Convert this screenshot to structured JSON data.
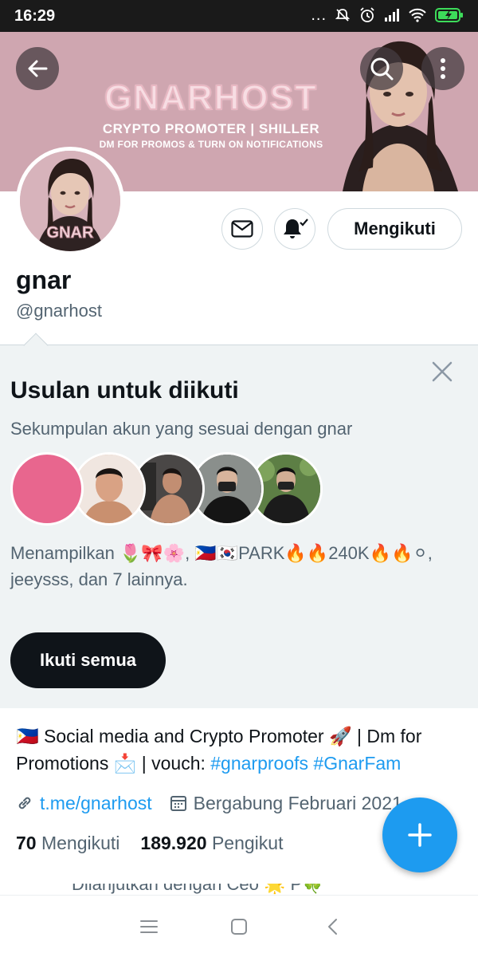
{
  "status_bar": {
    "time": "16:29",
    "dots": "..."
  },
  "banner": {
    "title": "GNARHOST",
    "subtitle": "CRYPTO PROMOTER | SHILLER",
    "tagline": "DM FOR PROMOS & TURN ON NOTIFICATIONS",
    "colors": {
      "background": "#cfa6b0"
    }
  },
  "avatar": {
    "logo_text": "GNAR"
  },
  "profile": {
    "follow_button": "Mengikuti",
    "name": "gnar",
    "handle": "@gnarhost"
  },
  "suggestions": {
    "title": "Usulan untuk diikuti",
    "subtitle": "Sekumpulan akun yang sesuai dengan gnar",
    "showing_text": "Menampilkan 🌷🎀🌸, 🇵🇭🇰🇷PARK🔥🔥240K🔥🔥⚪, jeeysss, dan 7 lainnya.",
    "follow_all": "Ikuti semua"
  },
  "bio": {
    "text_part1": "🇵🇭 Social media and Crypto Promoter 🚀 | Dm for Promotions 📩 | vouch: ",
    "hashtag1": "#gnarproofs",
    "hashtag2": "#GnarFam",
    "link": "t.me/gnarhost",
    "joined": "Bergabung Februari 2021",
    "following_count": "70",
    "following_label": "Mengikuti",
    "followers_count": "189.920",
    "followers_label": "Pengikut",
    "cut_text": "Dilanjutkan dengan Ceo 🌟 P🍀"
  },
  "colors": {
    "accent": "#1d9bf0",
    "text_secondary": "#536471",
    "panel_bg": "#eff3f4"
  },
  "icons": [
    "back-arrow-icon",
    "search-icon",
    "more-vertical-icon",
    "mail-icon",
    "bell-check-icon",
    "close-icon",
    "link-icon",
    "calendar-icon",
    "plus-icon",
    "menu-icon",
    "home-square-icon",
    "back-chevron-icon"
  ]
}
